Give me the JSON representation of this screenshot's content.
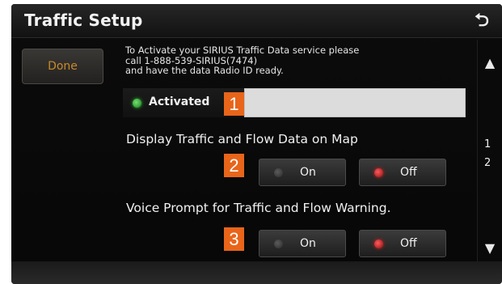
{
  "window": {
    "title": "Traffic Setup"
  },
  "header": {
    "back_icon": "back-arrow-icon"
  },
  "sidebar": {
    "done_label": "Done"
  },
  "info": {
    "line1": "To Activate your SIRIUS Traffic Data service please",
    "line2": "call 1-888-539-SIRIUS(7474)",
    "line3": "and have the data Radio ID ready."
  },
  "activation": {
    "status_label": "Activated",
    "status_color": "#2fbf2f",
    "radio_id_value": ""
  },
  "callouts": [
    "1",
    "2",
    "3"
  ],
  "sections": [
    {
      "label": "Display Traffic and Flow Data on Map",
      "options": [
        {
          "label": "On",
          "selected": false
        },
        {
          "label": "Off",
          "selected": true
        }
      ]
    },
    {
      "label": "Voice Prompt for Traffic and Flow Warning.",
      "options": [
        {
          "label": "On",
          "selected": false
        },
        {
          "label": "Off",
          "selected": true
        }
      ]
    }
  ],
  "pager": {
    "up_icon": "triangle-up-icon",
    "down_icon": "triangle-down-icon",
    "pages": [
      "1",
      "2"
    ]
  },
  "colors": {
    "accent": "#e8651a",
    "done_text": "#c88a2a",
    "selected_led": "#d02020"
  }
}
